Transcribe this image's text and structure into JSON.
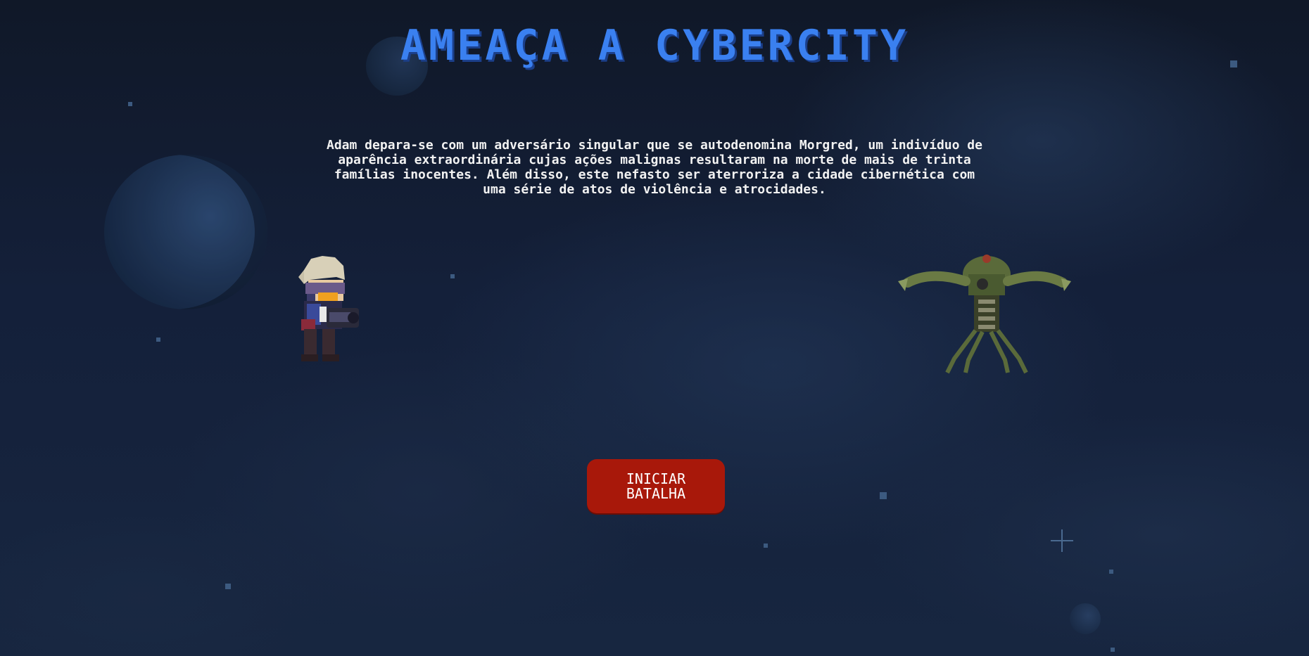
{
  "title": "AMEAÇA A CYBERCITY",
  "story": "Adam depara-se com um adversário singular que se autodenomina Morgred, um indivíduo de aparência extraordinária cujas ações malignas resultaram na morte de mais de trinta famílias inocentes. Além disso, este nefasto ser aterroriza a cidade cibernética com uma série de atos de violência e atrocidades.",
  "start_button_label": "INICIAR BATALHA",
  "colors": {
    "title": "#3a80f0",
    "button": "#a8180a",
    "background": "#0f1626"
  }
}
